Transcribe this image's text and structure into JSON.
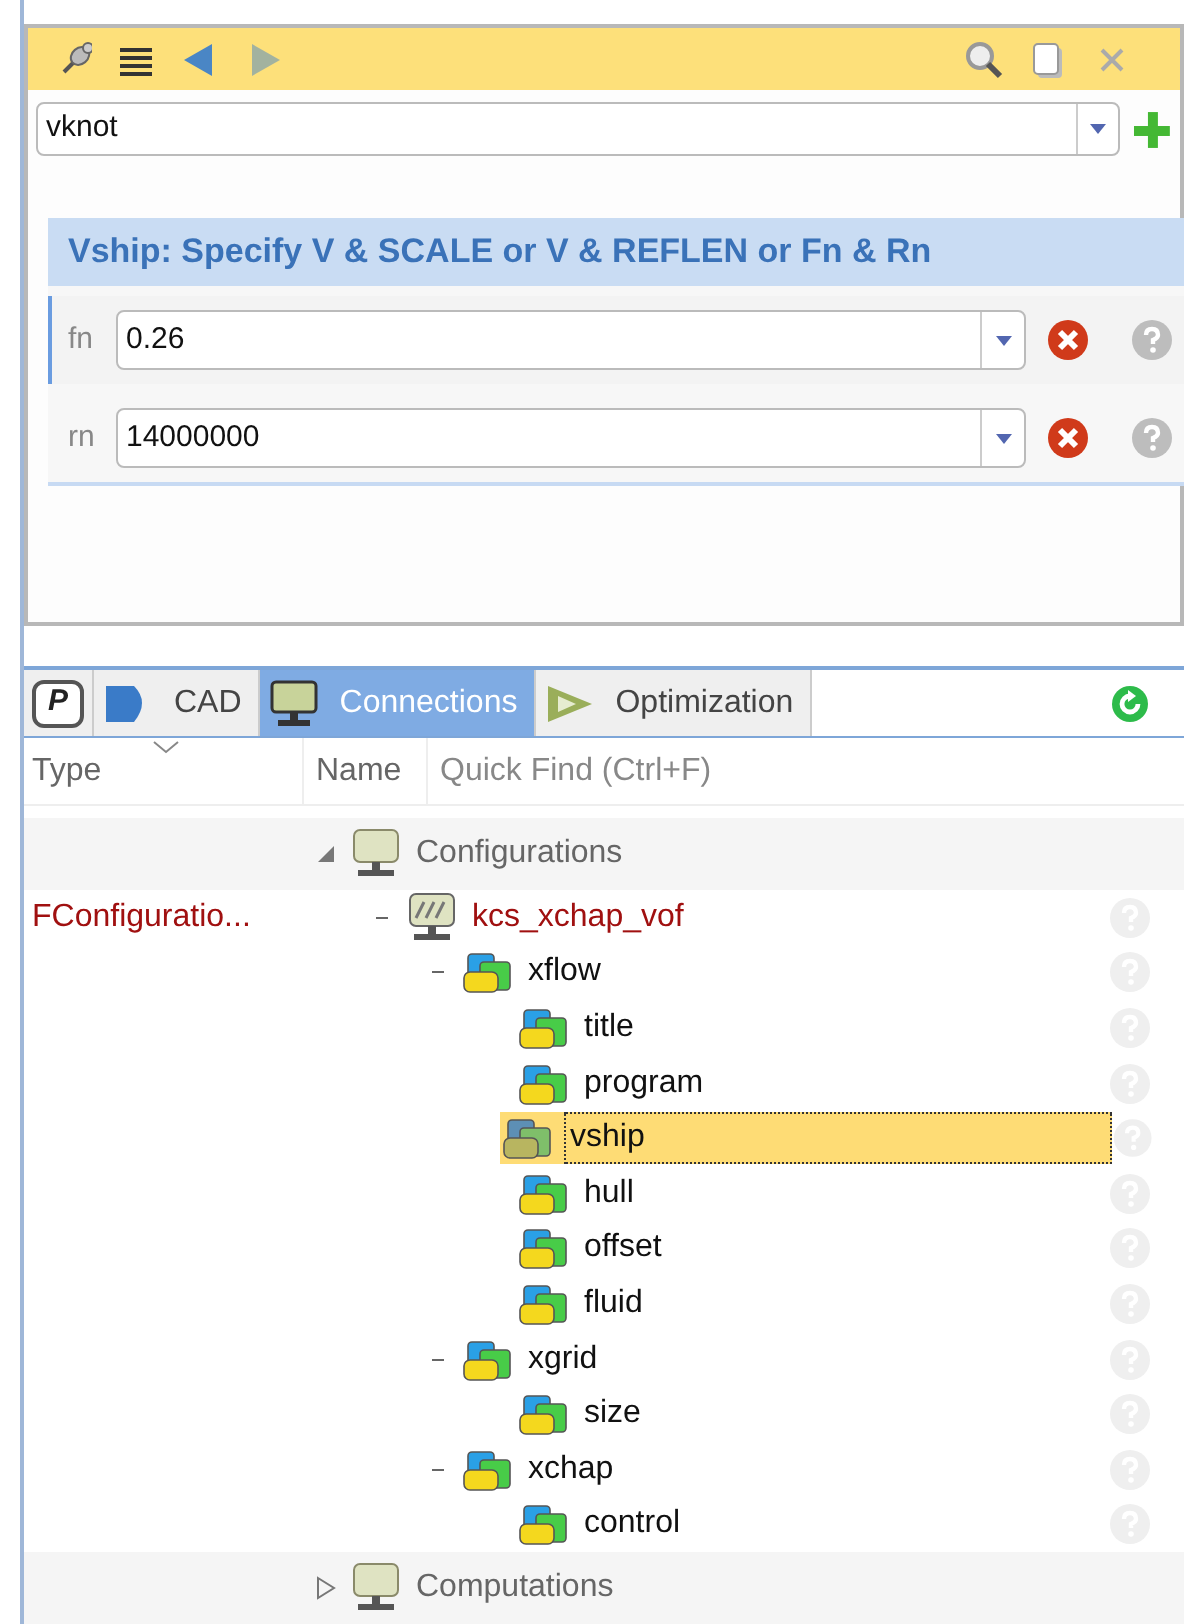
{
  "toolbar": {
    "buttons": [
      {
        "kind": "pin",
        "disabled": false
      },
      {
        "kind": "list",
        "disabled": false
      },
      {
        "kind": "back",
        "disabled": false
      },
      {
        "kind": "forward",
        "disabled": true
      }
    ],
    "right_buttons": [
      {
        "kind": "search"
      },
      {
        "kind": "copy"
      },
      {
        "kind": "close"
      }
    ]
  },
  "object_selector": {
    "value": "vknot"
  },
  "section": {
    "title": "Vship: Specify V & SCALE or V & REFLEN or Fn & Rn",
    "parameters": [
      {
        "label": "fn",
        "value": "0.26",
        "selected": true
      },
      {
        "label": "rn",
        "value": "14000000",
        "selected": false
      }
    ]
  },
  "tabs": [
    {
      "kind": "p",
      "label": "P",
      "selected": false
    },
    {
      "kind": "cad",
      "label": "CAD",
      "selected": false
    },
    {
      "kind": "connections",
      "label": "Connections",
      "selected": true
    },
    {
      "kind": "optimization",
      "label": "Optimization",
      "selected": false
    }
  ],
  "columns": [
    "Type",
    "Name",
    "Quick Find (Ctrl+F)"
  ],
  "tree": [
    {
      "label": "Configurations",
      "kind": "group",
      "expanded": true,
      "children": [
        {
          "label": "kcs_xchap_vof",
          "type": "FConfiguratio...",
          "kind": "config",
          "expanded": true,
          "selected": false,
          "children": [
            {
              "label": "xflow",
              "kind": "module",
              "expanded": true,
              "selected": false,
              "children": [
                {
                  "label": "title",
                  "kind": "module",
                  "selected": false
                },
                {
                  "label": "program",
                  "kind": "module",
                  "selected": false
                },
                {
                  "label": "vship",
                  "kind": "module",
                  "selected": true
                },
                {
                  "label": "hull",
                  "kind": "module",
                  "selected": false
                },
                {
                  "label": "offset",
                  "kind": "module",
                  "selected": false
                },
                {
                  "label": "fluid",
                  "kind": "module",
                  "selected": false
                }
              ]
            },
            {
              "label": "xgrid",
              "kind": "module",
              "expanded": true,
              "selected": false,
              "children": [
                {
                  "label": "size",
                  "kind": "module",
                  "selected": false
                }
              ]
            },
            {
              "label": "xchap",
              "kind": "module",
              "expanded": true,
              "selected": false,
              "children": [
                {
                  "label": "control",
                  "kind": "module",
                  "selected": false
                }
              ]
            }
          ]
        }
      ]
    },
    {
      "label": "Computations",
      "kind": "group",
      "expanded": false
    }
  ]
}
